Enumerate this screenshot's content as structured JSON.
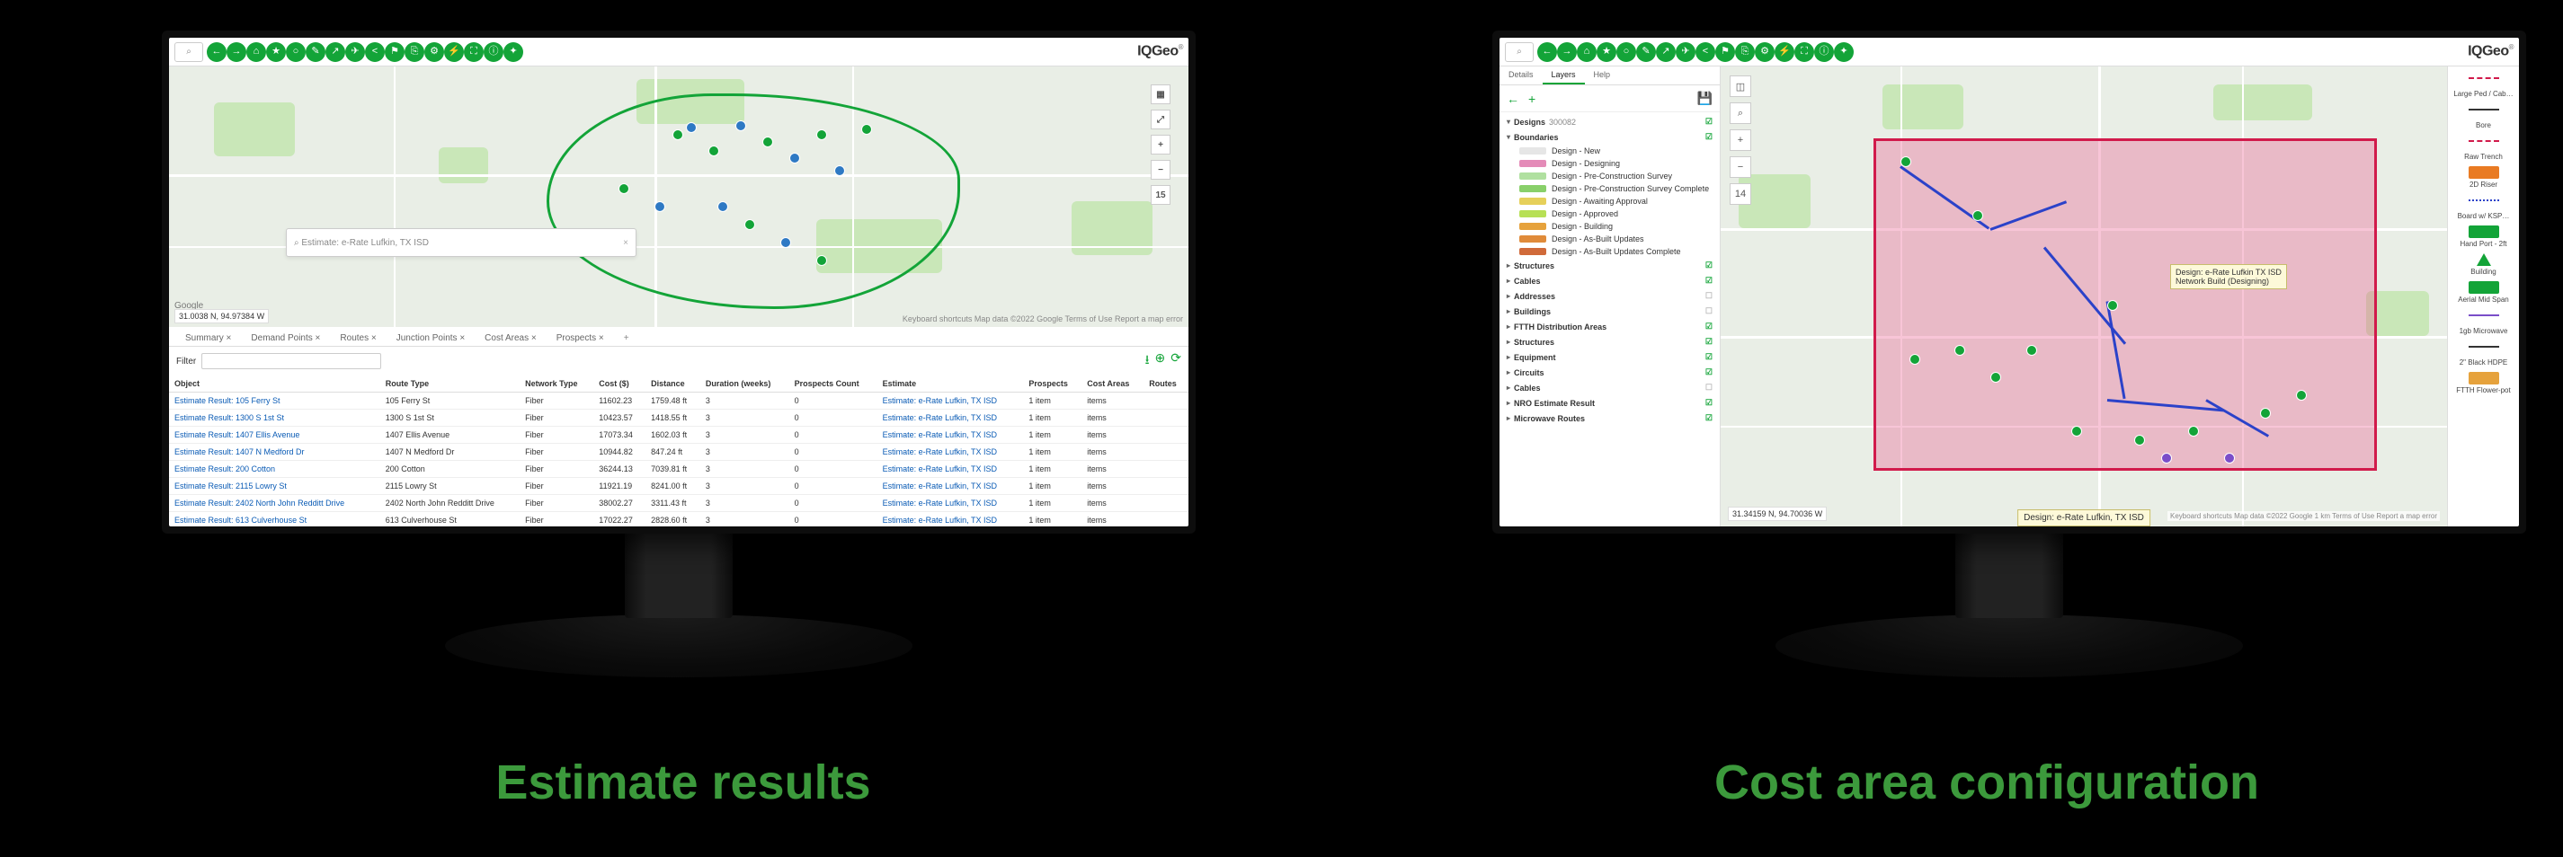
{
  "captions": {
    "left": "Estimate results",
    "right": "Cost area configuration"
  },
  "logo": "IQGeo",
  "toolbar_icons": [
    "←",
    "→",
    "⌂",
    "★",
    "○",
    "✎",
    "↗",
    "✈",
    "<",
    "⚑",
    "⎘",
    "⚙",
    "⚡",
    "⛶",
    "ⓘ",
    "✦"
  ],
  "search_icon": "⌕",
  "screen1": {
    "search_value": "Estimate: e-Rate Lufkin, TX ISD",
    "coords": "31.0038 N, 94.97384 W",
    "google": "Google",
    "attrib": "Keyboard shortcuts   Map data ©2022 Google   Terms of Use   Report a map error",
    "zoom_plus": "+",
    "zoom_minus": "−",
    "zoom_val": "15",
    "tabs": [
      "Summary ×",
      "Demand Points ×",
      "Routes ×",
      "Junction Points ×",
      "Cost Areas ×",
      "Prospects ×"
    ],
    "filter_label": "Filter",
    "export_icon": "⭳",
    "zoom_icon": "⊕",
    "refresh_icon": "⟳",
    "columns": [
      "Object",
      "Route Type",
      "Network Type",
      "Cost ($)",
      "Distance",
      "Duration (weeks)",
      "Prospects Count",
      "Estimate",
      "Prospects",
      "Cost Areas",
      "Routes"
    ],
    "rows": [
      {
        "name": "Estimate Result: 105 Ferry St",
        "rtype": "105 Ferry St",
        "ntype": "Fiber",
        "cost": "11602.23",
        "dist": "1759.48 ft",
        "dur": "3",
        "pc": "0",
        "est": "Estimate: e-Rate Lufkin, TX ISD",
        "pros": "1 item",
        "ca": "items",
        "rt": ""
      },
      {
        "name": "Estimate Result: 1300 S 1st St",
        "rtype": "1300 S 1st St",
        "ntype": "Fiber",
        "cost": "10423.57",
        "dist": "1418.55 ft",
        "dur": "3",
        "pc": "0",
        "est": "Estimate: e-Rate Lufkin, TX ISD",
        "pros": "1 item",
        "ca": "items",
        "rt": ""
      },
      {
        "name": "Estimate Result: 1407 Ellis Avenue",
        "rtype": "1407 Ellis Avenue",
        "ntype": "Fiber",
        "cost": "17073.34",
        "dist": "1602.03 ft",
        "dur": "3",
        "pc": "0",
        "est": "Estimate: e-Rate Lufkin, TX ISD",
        "pros": "1 item",
        "ca": "items",
        "rt": ""
      },
      {
        "name": "Estimate Result: 1407 N Medford Dr",
        "rtype": "1407 N Medford Dr",
        "ntype": "Fiber",
        "cost": "10944.82",
        "dist": "847.24 ft",
        "dur": "3",
        "pc": "0",
        "est": "Estimate: e-Rate Lufkin, TX ISD",
        "pros": "1 item",
        "ca": "items",
        "rt": ""
      },
      {
        "name": "Estimate Result: 200 Cotton",
        "rtype": "200 Cotton",
        "ntype": "Fiber",
        "cost": "36244.13",
        "dist": "7039.81 ft",
        "dur": "3",
        "pc": "0",
        "est": "Estimate: e-Rate Lufkin, TX ISD",
        "pros": "1 item",
        "ca": "items",
        "rt": ""
      },
      {
        "name": "Estimate Result: 2115 Lowry St",
        "rtype": "2115 Lowry St",
        "ntype": "Fiber",
        "cost": "11921.19",
        "dist": "8241.00 ft",
        "dur": "3",
        "pc": "0",
        "est": "Estimate: e-Rate Lufkin, TX ISD",
        "pros": "1 item",
        "ca": "items",
        "rt": ""
      },
      {
        "name": "Estimate Result: 2402 North John Redditt Drive",
        "rtype": "2402 North John Redditt Drive",
        "ntype": "Fiber",
        "cost": "38002.27",
        "dist": "3311.43 ft",
        "dur": "3",
        "pc": "0",
        "est": "Estimate: e-Rate Lufkin, TX ISD",
        "pros": "1 item",
        "ca": "items",
        "rt": ""
      },
      {
        "name": "Estimate Result: 613 Culverhouse St",
        "rtype": "613 Culverhouse St",
        "ntype": "Fiber",
        "cost": "17022.27",
        "dist": "2828.60 ft",
        "dur": "3",
        "pc": "0",
        "est": "Estimate: e-Rate Lufkin, TX ISD",
        "pros": "1 item",
        "ca": "items",
        "rt": ""
      }
    ]
  },
  "screen2": {
    "coords": "31.34159 N, 94.70036 W",
    "map_attrib": "Keyboard shortcuts   Map data ©2022 Google   1 km   Terms of Use   Report a map error",
    "side_tabs": [
      "Details",
      "Layers",
      "Help"
    ],
    "side_tools": {
      "back": "←",
      "add": "+",
      "save": "💾"
    },
    "mini_stack": [
      "◫",
      "⌕",
      "+",
      "−",
      "14"
    ],
    "tooltip": "Design: e-Rate Lufkin TX ISD\nNetwork Build (Designing)",
    "bottom_tip": "Design: e-Rate Lufkin, TX ISD",
    "groups": {
      "designs": {
        "label": "Designs",
        "count": "300082",
        "chk": true
      },
      "boundaries": {
        "label": "Boundaries",
        "chk": true
      },
      "boundaries_items": [
        {
          "label": "Design - New",
          "color": "#e6e6e6"
        },
        {
          "label": "Design - Designing",
          "color": "#e48bb8"
        },
        {
          "label": "Design - Pre-Construction Survey",
          "color": "#b0e0a0"
        },
        {
          "label": "Design - Pre-Construction Survey Complete",
          "color": "#89d06a"
        },
        {
          "label": "Design - Awaiting Approval",
          "color": "#e6d05a"
        },
        {
          "label": "Design - Approved",
          "color": "#b7e055"
        },
        {
          "label": "Design - Building",
          "color": "#e6a23c"
        },
        {
          "label": "Design - As-Built Updates",
          "color": "#e08b3a"
        },
        {
          "label": "Design - As-Built Updates Complete",
          "color": "#d06a3a"
        }
      ],
      "structures": {
        "label": "Structures",
        "chk": true
      },
      "cables": {
        "label": "Cables",
        "chk": true
      },
      "addresses": {
        "label": "Addresses",
        "chk": false
      },
      "buildings": {
        "label": "Buildings",
        "chk": false
      },
      "ftth": {
        "label": "FTTH Distribution Areas",
        "chk": true
      },
      "structures2": {
        "label": "Structures",
        "chk": true
      },
      "equipment": {
        "label": "Equipment",
        "chk": true
      },
      "circuits": {
        "label": "Circuits",
        "chk": true
      },
      "cables2": {
        "label": "Cables",
        "chk": false
      },
      "nro": {
        "label": "NRO Estimate Result",
        "chk": true
      },
      "microwave": {
        "label": "Microwave Routes",
        "chk": true
      }
    },
    "legend": [
      {
        "label": "Large Ped / Cab…",
        "sym": "dash"
      },
      {
        "label": "Bore",
        "sym": "line"
      },
      {
        "label": "Raw Trench",
        "sym": "dash"
      },
      {
        "label": "2D Riser",
        "sym": "sq"
      },
      {
        "label": "Board w/ KSP…",
        "sym": "dot"
      },
      {
        "label": "Hand Port - 2ft",
        "sym": "sqg"
      },
      {
        "label": "Building",
        "sym": "tri"
      },
      {
        "label": "Aerial Mid Span",
        "sym": "sqg"
      },
      {
        "label": "1gb Microwave",
        "sym": "purp"
      },
      {
        "label": "2\" Black HDPE",
        "sym": "line"
      },
      {
        "label": "FTTH Flower-pot",
        "sym": "orng"
      }
    ]
  }
}
